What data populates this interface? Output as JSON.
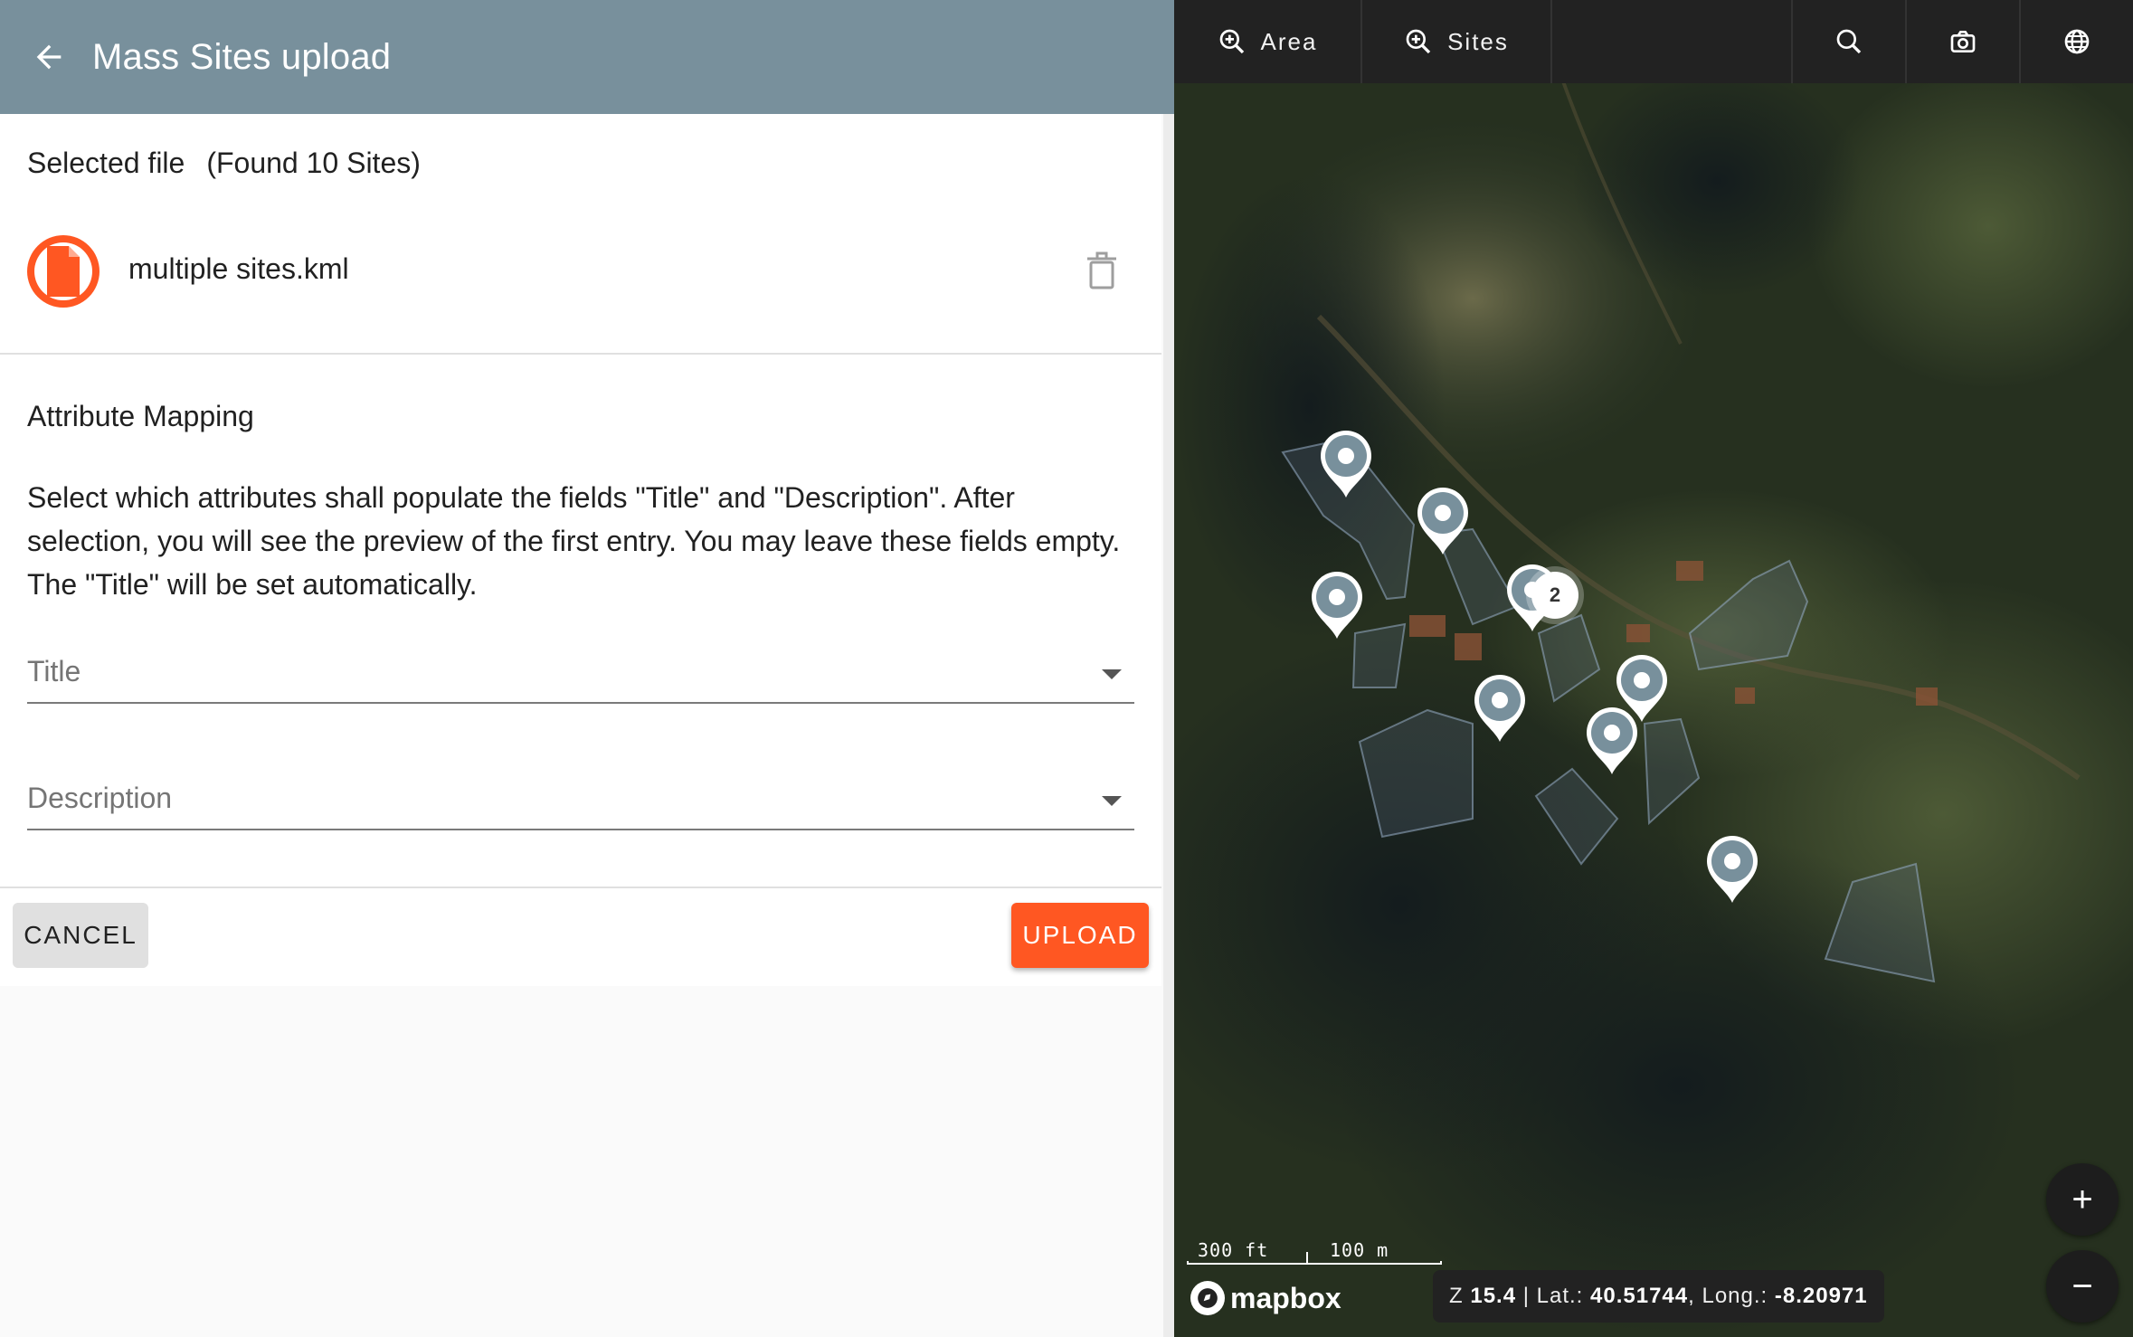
{
  "header": {
    "title": "Mass Sites upload"
  },
  "file": {
    "selected_label": "Selected file",
    "found_label": "(Found 10 Sites)",
    "name": "multiple sites.kml"
  },
  "mapping": {
    "title": "Attribute Mapping",
    "description": "Select which attributes shall populate the fields \"Title\" and \"Description\". After selection, you will see the preview of the first entry. You may leave these fields empty. The \"Title\" will be set automatically.",
    "title_field": {
      "placeholder": "Title"
    },
    "description_field": {
      "placeholder": "Description"
    }
  },
  "actions": {
    "cancel": "CANCEL",
    "upload": "UPLOAD"
  },
  "map": {
    "toolbar": {
      "area": "Area",
      "sites": "Sites"
    },
    "zoom_in": "+",
    "zoom_out": "−",
    "scale_ft": "300 ft",
    "scale_m": "100 m",
    "attribution": "mapbox",
    "coords": {
      "z_label": "Z",
      "z": "15.4",
      "lat_label": "Lat.:",
      "lat": "40.51744",
      "long_label": "Long.:",
      "long": "-8.20971"
    },
    "cluster_count": "2",
    "marker_count": 9
  },
  "colors": {
    "header_bg": "#78909c",
    "accent": "#ff5722",
    "map_toolbar": "#222222",
    "pin": "#78909c"
  }
}
